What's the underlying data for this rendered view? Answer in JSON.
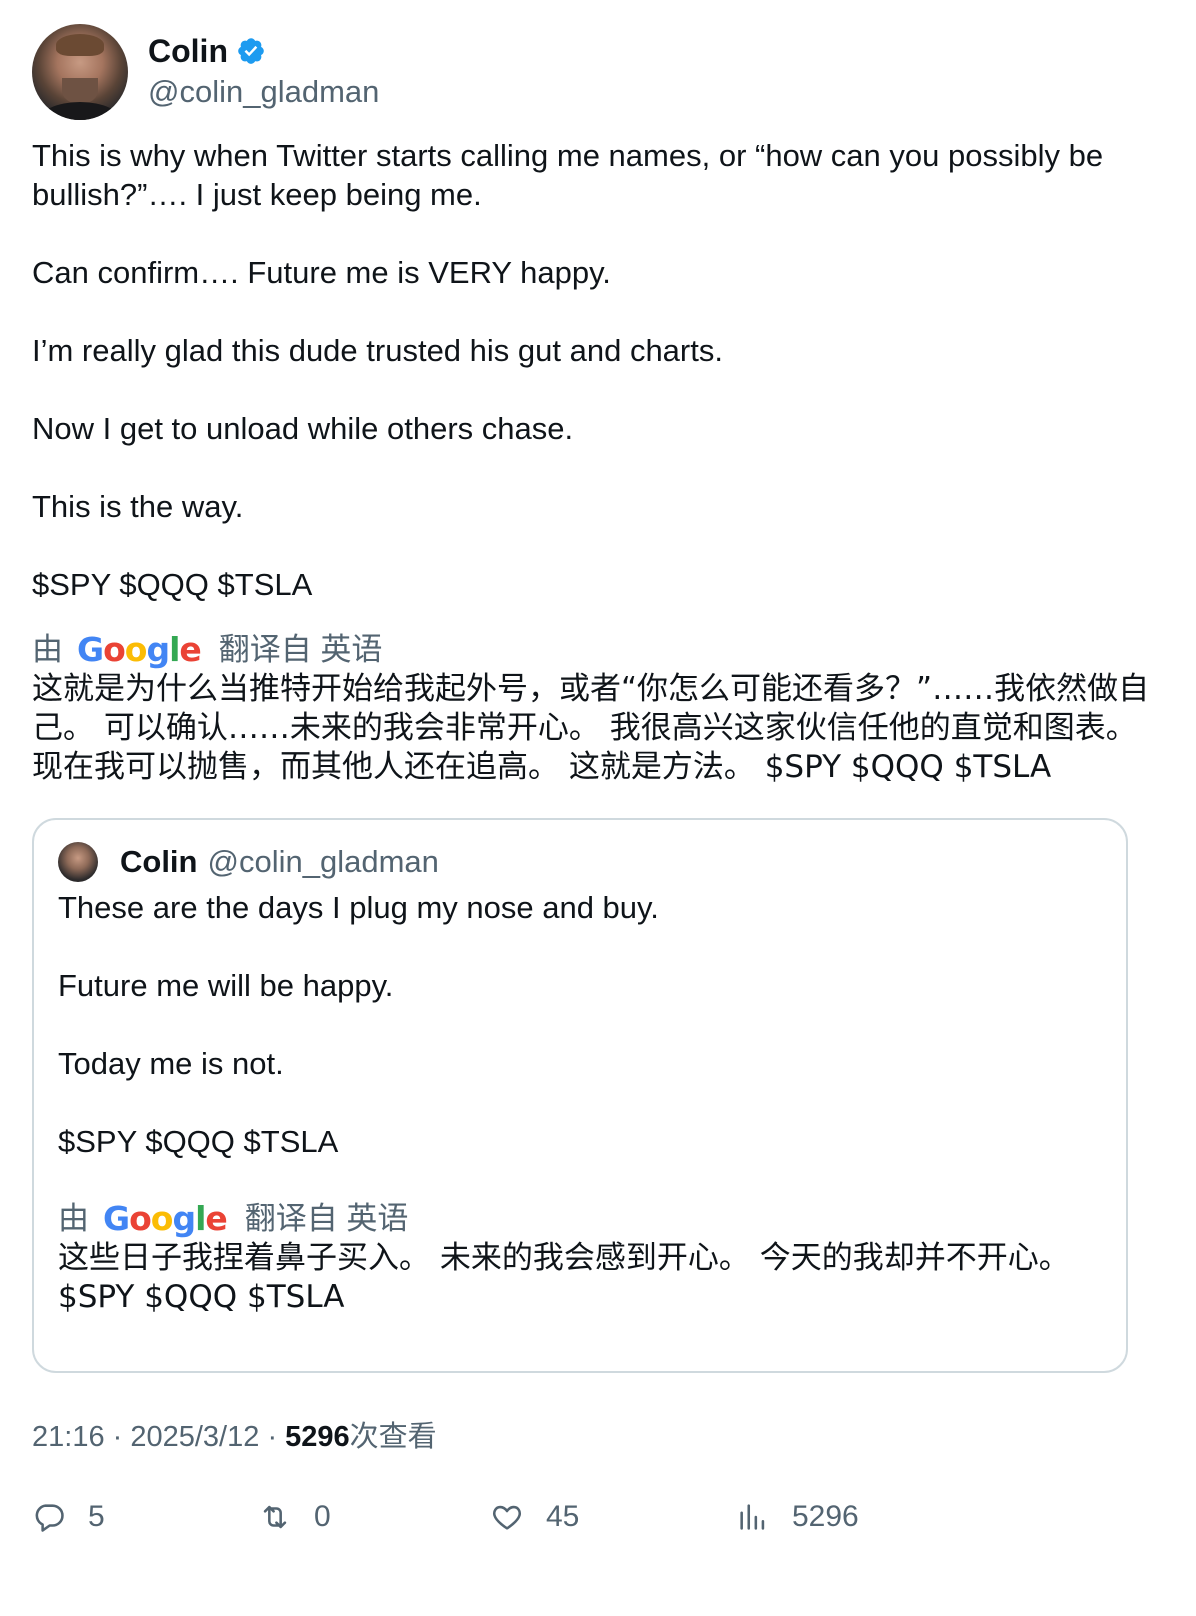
{
  "author": {
    "name": "Colin",
    "handle": "@colin_gladman"
  },
  "tweet": {
    "paragraphs": [
      "This is why when Twitter starts calling me names, or “how can you possibly be bullish?”…. I just keep being me.",
      "Can confirm…. Future me is VERY happy.",
      "I’m really glad this dude trusted his gut and charts.",
      "Now I get to unload while others chase.",
      "This is the way.",
      "$SPY $QQQ $TSLA"
    ],
    "translate_prefix": "由",
    "translate_suffix": "翻译自 英语",
    "translation": "这就是为什么当推特开始给我起外号，或者“你怎么可能还看多？”……我依然做自己。 可以确认……未来的我会非常开心。 我很高兴这家伙信任他的直觉和图表。 现在我可以抛售，而其他人还在追高。 这就是方法。 $SPY $QQQ $TSLA"
  },
  "quote": {
    "name": "Colin",
    "handle": "@colin_gladman",
    "paragraphs": [
      "These are the days I plug my nose and buy.",
      "Future me will be happy.",
      "Today me is not.",
      "$SPY $QQQ $TSLA"
    ],
    "translate_prefix": "由",
    "translate_suffix": "翻译自 英语",
    "translation": "这些日子我捏着鼻子买入。 未来的我会感到开心。 今天的我却并不开心。 $SPY $QQQ $TSLA"
  },
  "meta": {
    "time": "21:16",
    "date": "2025/3/12",
    "views": "5296",
    "views_label": "次查看"
  },
  "actions": {
    "replies": "5",
    "reposts": "0",
    "likes": "45",
    "views": "5296"
  },
  "colors": {
    "verified": "#1d9bf0",
    "secondary_text": "#536471",
    "primary_text": "#0f1419",
    "border": "#cfd9de"
  },
  "icons": [
    "verified-badge-icon",
    "reply-icon",
    "repost-icon",
    "like-icon",
    "analytics-icon"
  ]
}
